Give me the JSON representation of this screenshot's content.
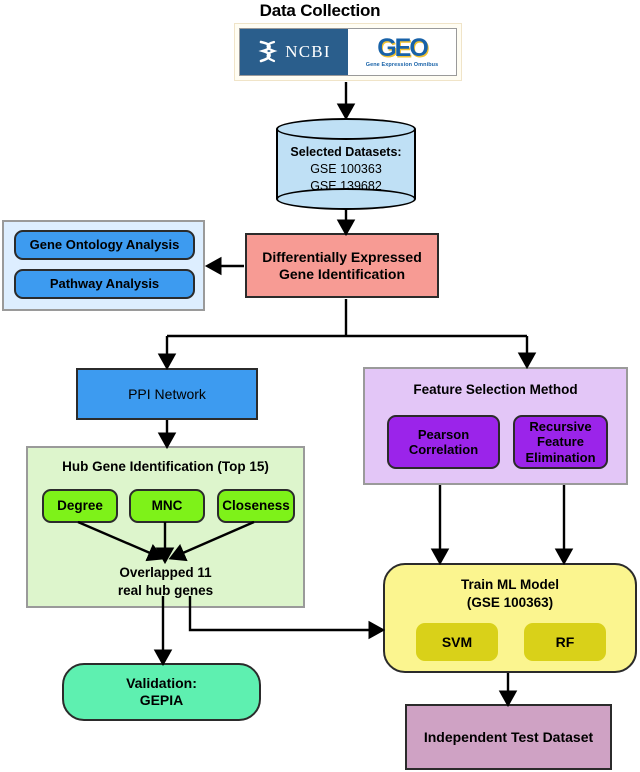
{
  "diagram": {
    "title": "Data Collection",
    "type": "flowchart"
  },
  "logos": {
    "ncbi_label": "NCBI",
    "ncbi_icon": "ncbi-helix-icon",
    "geo_word": "GEO",
    "geo_subtitle": "Gene Expression Omnibus"
  },
  "datasets_node": {
    "heading": "Selected Datasets:",
    "items": [
      "GSE 100363",
      "GSE 139682"
    ]
  },
  "enrichment_panel": {
    "items": [
      {
        "label": "Gene Ontology Analysis"
      },
      {
        "label": "Pathway Analysis"
      }
    ]
  },
  "deg_node": {
    "line1": "Differentially Expressed",
    "line2": "Gene Identification"
  },
  "ppi_node": {
    "label": "PPI Network"
  },
  "feature_selection_panel": {
    "title": "Feature Selection Method",
    "methods": [
      {
        "lines": [
          "Pearson",
          "Correlation"
        ]
      },
      {
        "lines": [
          "Recursive",
          "Feature",
          "Elimination"
        ]
      }
    ]
  },
  "hub_gene_panel": {
    "title": "Hub Gene Identification (Top 15)",
    "metrics": [
      {
        "label": "Degree"
      },
      {
        "label": "MNC"
      },
      {
        "label": "Closeness"
      }
    ],
    "result": {
      "line1": "Overlapped 11",
      "line2": "real hub genes"
    }
  },
  "train_model_node": {
    "line1": "Train ML Model",
    "line2": "(GSE 100363)",
    "models": [
      {
        "label": "SVM"
      },
      {
        "label": "RF"
      }
    ]
  },
  "validation_node": {
    "line1": "Validation:",
    "line2": "GEPIA"
  },
  "test_dataset_node": {
    "label": "Independent Test Dataset"
  },
  "colors": {
    "panel_light_blue": "#ddeeff",
    "blue": "#3d9bf0",
    "salmon": "#f79b94",
    "lavender": "#e3c6f7",
    "purple": "#9b24ea",
    "light_green": "#ddf5cc",
    "green": "#7ef219",
    "yellow": "#fbf58f",
    "dark_yellow": "#d9d119",
    "mint": "#5ef0b0",
    "mauve": "#cfa2c4",
    "cylinder_blue": "#bfe0f5",
    "ncbi_blue": "#2a5e8c",
    "geo_blue": "#1862a8",
    "geo_gold": "#f2c230",
    "connector": "#000000"
  }
}
